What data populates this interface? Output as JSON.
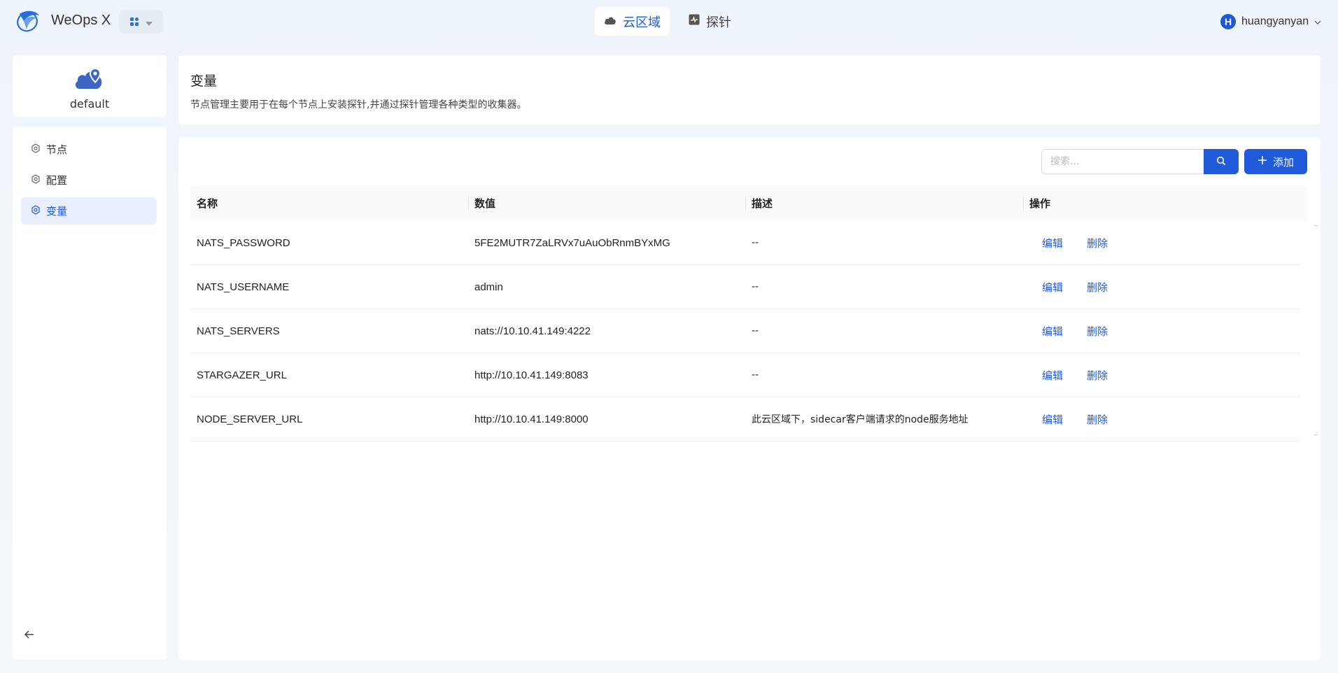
{
  "app": {
    "name": "WeOps X"
  },
  "nav": {
    "tabs": [
      {
        "label": "云区域",
        "icon": "cloud-icon",
        "active": true
      },
      {
        "label": "探针",
        "icon": "probe-icon",
        "active": false
      }
    ]
  },
  "user": {
    "initial": "H",
    "name": "huangyanyan"
  },
  "sidebar": {
    "region_label": "default",
    "items": [
      {
        "label": "节点",
        "icon": "gear-icon",
        "active": false
      },
      {
        "label": "配置",
        "icon": "gear-icon",
        "active": false
      },
      {
        "label": "变量",
        "icon": "gear-icon",
        "active": true
      }
    ]
  },
  "header": {
    "title": "变量",
    "description": "节点管理主要用于在每个节点上安装探针,并通过探针管理各种类型的收集器。"
  },
  "toolbar": {
    "search_placeholder": "搜索...",
    "add_label": "添加"
  },
  "table": {
    "columns": [
      "名称",
      "数值",
      "描述",
      "操作"
    ],
    "rows": [
      {
        "name": "NATS_PASSWORD",
        "value": "5FE2MUTR7ZaLRVx7uAuObRnmBYxMG",
        "desc": "--",
        "edit": "编辑",
        "delete": "删除"
      },
      {
        "name": "NATS_USERNAME",
        "value": "admin",
        "desc": "--",
        "edit": "编辑",
        "delete": "删除"
      },
      {
        "name": "NATS_SERVERS",
        "value": "nats://10.10.41.149:4222",
        "desc": "--",
        "edit": "编辑",
        "delete": "删除"
      },
      {
        "name": "STARGAZER_URL",
        "value": "http://10.10.41.149:8083",
        "desc": "--",
        "edit": "编辑",
        "delete": "删除"
      },
      {
        "name": "NODE_SERVER_URL",
        "value": "http://10.10.41.149:8000",
        "desc": "此云区域下，sidecar客户端请求的node服务地址",
        "edit": "编辑",
        "delete": "删除"
      }
    ]
  },
  "colors": {
    "primary": "#1f5ad8",
    "active_bg": "#e9effc"
  }
}
